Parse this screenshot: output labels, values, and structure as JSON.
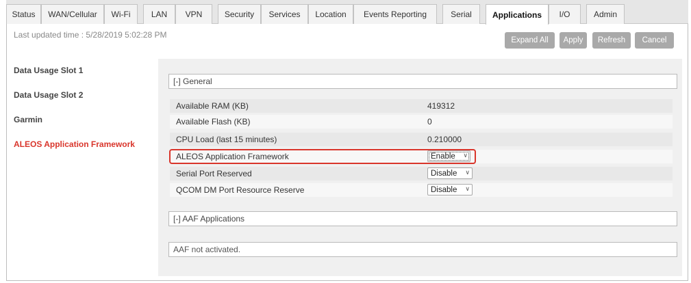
{
  "tabs": [
    {
      "label": "Status"
    },
    {
      "label": "WAN/Cellular"
    },
    {
      "label": "Wi-Fi"
    },
    {
      "label": "LAN"
    },
    {
      "label": "VPN"
    },
    {
      "label": "Security"
    },
    {
      "label": "Services"
    },
    {
      "label": "Location"
    },
    {
      "label": "Events Reporting"
    },
    {
      "label": "Serial"
    },
    {
      "label": "Applications"
    },
    {
      "label": "I/O"
    },
    {
      "label": "Admin"
    }
  ],
  "active_tab": "Applications",
  "header": {
    "last_updated": "Last updated time : 5/28/2019 5:02:28 PM"
  },
  "toolbar": {
    "expand_all": "Expand All",
    "apply": "Apply",
    "refresh": "Refresh",
    "cancel": "Cancel"
  },
  "sidebar": {
    "items": [
      {
        "label": "Data Usage Slot 1"
      },
      {
        "label": "Data Usage Slot 2"
      },
      {
        "label": "Garmin"
      },
      {
        "label": "ALEOS Application Framework"
      }
    ],
    "active": "ALEOS Application Framework"
  },
  "general": {
    "header": "[-] General",
    "rows": [
      {
        "label": "Available RAM (KB)",
        "value": "419312"
      },
      {
        "label": "Available Flash (KB)",
        "value": "0"
      },
      {
        "label": "CPU Load (last 15 minutes)",
        "value": "0.210000"
      },
      {
        "label": "ALEOS Application Framework",
        "value": "Enable"
      },
      {
        "label": "Serial Port Reserved",
        "value": "Disable"
      },
      {
        "label": "QCOM DM Port Resource Reserve",
        "value": "Disable"
      }
    ]
  },
  "aaf": {
    "header": "[-] AAF Applications",
    "message": "AAF not activated."
  },
  "colors": {
    "accent_red": "#d9352b",
    "button_gray": "#a9a9a9"
  }
}
